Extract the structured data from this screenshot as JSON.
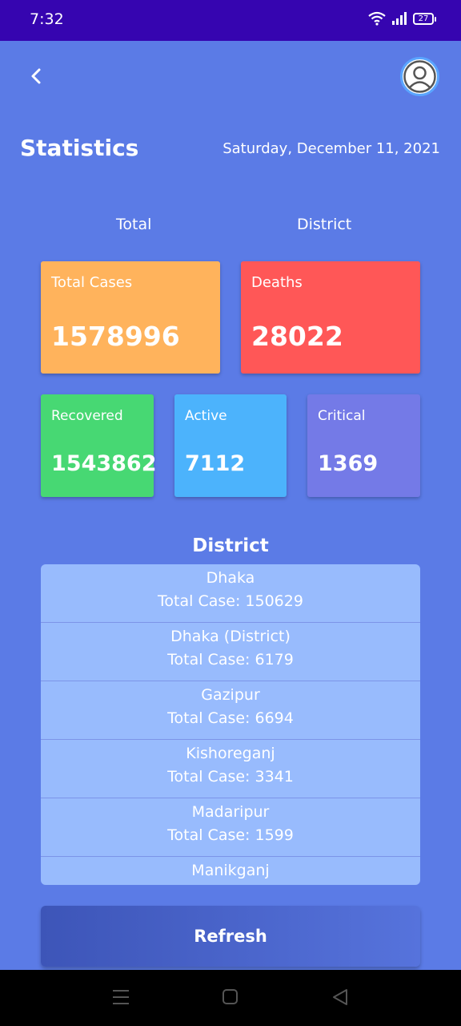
{
  "status_bar": {
    "time": "7:32",
    "battery": "27"
  },
  "header": {
    "title": "Statistics",
    "date": "Saturday, December 11, 2021"
  },
  "tabs": [
    {
      "label": "Total"
    },
    {
      "label": "District"
    }
  ],
  "stats": {
    "total_cases": {
      "label": "Total Cases",
      "value": "1578996",
      "color": "#ffb35c"
    },
    "deaths": {
      "label": "Deaths",
      "value": "28022",
      "color": "#ff5757"
    },
    "recovered": {
      "label": "Recovered",
      "value": "1543862",
      "color": "#47d873"
    },
    "active": {
      "label": "Active",
      "value": "7112",
      "color": "#4cb3fc"
    },
    "critical": {
      "label": "Critical",
      "value": "1369",
      "color": "#747ae7"
    }
  },
  "district_section": {
    "heading": "District",
    "items": [
      {
        "name": "Dhaka",
        "total": "Total Case: 150629"
      },
      {
        "name": "Dhaka (District)",
        "total": "Total Case: 6179"
      },
      {
        "name": "Gazipur",
        "total": "Total Case: 6694"
      },
      {
        "name": "Kishoreganj",
        "total": "Total Case: 3341"
      },
      {
        "name": "Madaripur",
        "total": "Total Case: 1599"
      },
      {
        "name": "Manikganj",
        "total": ""
      }
    ]
  },
  "refresh_label": "Refresh",
  "icons": {
    "back": "chevron-left-icon",
    "profile": "user-avatar-icon",
    "wifi": "wifi-icon",
    "signal": "signal-icon",
    "battery": "battery-icon",
    "nav_menu": "menu-icon",
    "nav_home": "home-icon",
    "nav_back": "back-triangle-icon"
  },
  "colors": {
    "background": "#5b7be6",
    "status_bar": "#3605b0",
    "district_list": "#98bbfd"
  }
}
